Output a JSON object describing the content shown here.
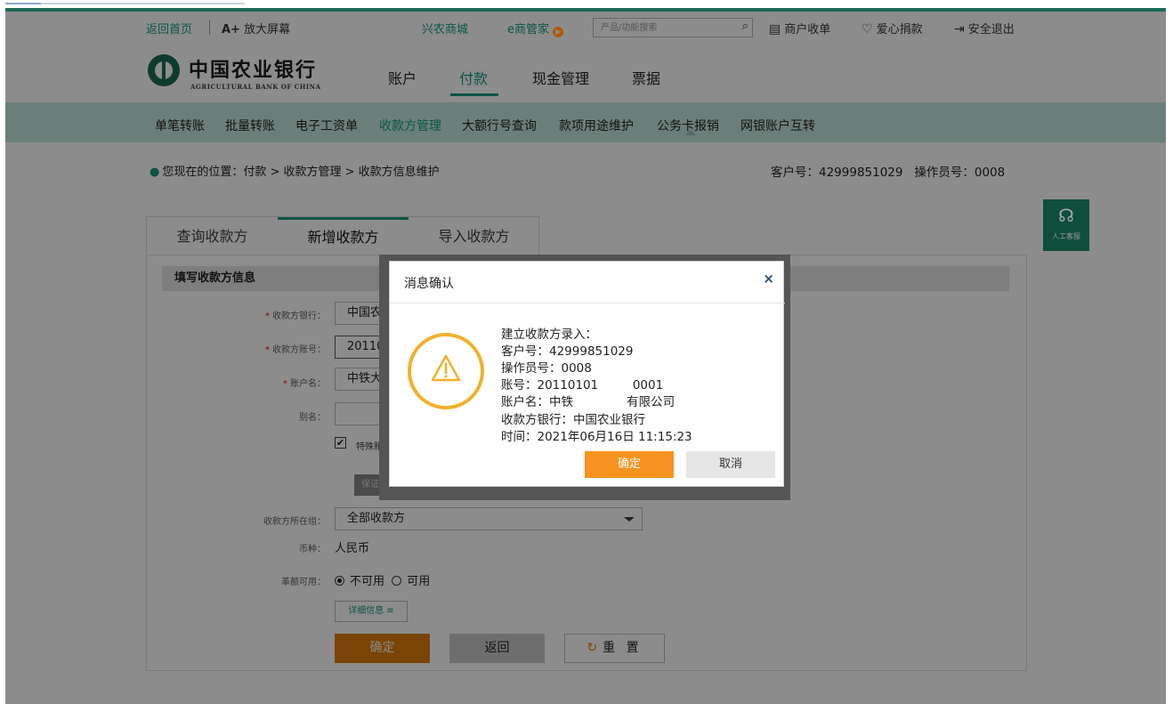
{
  "utilbar": {
    "home": "返回首页",
    "enlarge_prefix": "A+",
    "enlarge": "放大屏幕",
    "mall": "兴农商城",
    "emanager": "e商管家",
    "search_placeholder": "产品/功能搜索",
    "merchant": "商户收单",
    "charity": "爱心捐款",
    "logout": "安全退出"
  },
  "header": {
    "bank_name_cn": "中国农业银行",
    "bank_name_en": "AGRICULTURAL BANK OF CHINA",
    "nav": [
      "账户",
      "付款",
      "现金管理",
      "票据"
    ],
    "active_nav": "付款"
  },
  "subnav": {
    "items": [
      "单笔转账",
      "批量转账",
      "电子工资单",
      "收款方管理",
      "大额行号查询",
      "款项用途维护",
      "公务卡报销",
      "网银账户互转"
    ],
    "active": "收款方管理"
  },
  "location": {
    "text": "您现在的位置：付款 > 收款方管理 > 收款方信息维护",
    "customer": "客户号：42999851029",
    "operator": "操作员号：0008"
  },
  "service": {
    "label": "人工客服"
  },
  "tabs": [
    "查询收款方",
    "新增收款方",
    "导入收款方"
  ],
  "form": {
    "section_title": "填写收款方信息",
    "bank_label": "收款方银行：",
    "bank_value": "中国农",
    "account_label": "收款方账号：",
    "account_value": "20110",
    "name_label": "账户名：",
    "name_value": "中铁大",
    "alias_label": "别名：",
    "special_label": "特殊账",
    "guarantee_btn": "保证",
    "group_label": "收款方所在组：",
    "group_value": "全部收款方",
    "currency_label": "币种：",
    "currency_value": "人民币",
    "quota_label": "革额可用：",
    "quota_off": "不可用",
    "quota_on": "可用",
    "detail_btn": "详细信息 ≡",
    "confirm": "确定",
    "back": "返回",
    "reset": "重 置"
  },
  "modal": {
    "title": "消息确认",
    "close": "×",
    "lines": [
      "建立收款方录入：",
      "客户号：42999851029",
      "操作员号：0008",
      "账号：20110101         0001",
      "账户名：中铁              有限公司",
      "收款方银行：中国农业银行",
      "时间：2021年06月16日 11:15:23"
    ],
    "ok": "确定",
    "cancel": "取消"
  },
  "colors": {
    "brand_green": "#0b5446",
    "confirm_orange": "#f79320",
    "warning_yellow": "#f0b22b"
  }
}
